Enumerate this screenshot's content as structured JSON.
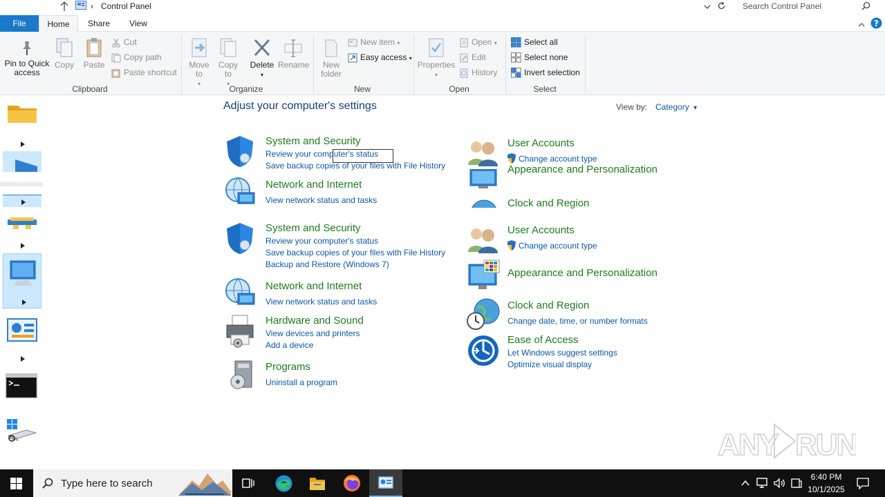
{
  "titlebar": {
    "location": "Control Panel",
    "search_placeholder": "Search Control Panel"
  },
  "tabs": [
    "File",
    "Home",
    "Share",
    "View"
  ],
  "ribbon": {
    "pin": "Pin to Quick access",
    "copy": "Copy",
    "paste": "Paste",
    "cut": "Cut",
    "copy_path": "Copy path",
    "paste_shortcut": "Paste shortcut",
    "clipboard": "Clipboard",
    "move_to": "Move to",
    "copy_to": "Copy to",
    "delete": "Delete",
    "rename": "Rename",
    "organize": "Organize",
    "new_folder": "New folder",
    "new_item": "New item",
    "easy_access": "Easy access",
    "new": "New",
    "properties": "Properties",
    "open": "Open",
    "edit": "Edit",
    "history": "History",
    "open_group": "Open",
    "select_all": "Select all",
    "select_none": "Select none",
    "invert_selection": "Invert selection",
    "select": "Select"
  },
  "content": {
    "heading": "Adjust your computer's settings",
    "view_by_label": "View by:",
    "view_by_value": "Category",
    "ghost": {
      "system_security": "System and Security",
      "review_status": "Review your computer's status",
      "save_backup": "Save backup copies of your files with File History",
      "network": "Network and Internet",
      "view_network": "View network status and tasks",
      "user_accounts": "User Accounts",
      "change_account": "Change account type",
      "appearance": "Appearance and Personalization",
      "clock": "Clock and Region"
    },
    "left": {
      "system_security": "System and Security",
      "review_status": "Review your computer's status",
      "save_backup": "Save backup copies of your files with File History",
      "backup_restore": "Backup and Restore (Windows 7)",
      "network": "Network and Internet",
      "view_network": "View network status and tasks",
      "hardware": "Hardware and Sound",
      "devices": "View devices and printers",
      "add_device": "Add a device",
      "programs": "Programs",
      "uninstall": "Uninstall a program"
    },
    "right": {
      "user_accounts": "User Accounts",
      "change_account": "Change account type",
      "appearance": "Appearance and Personalization",
      "clock": "Clock and Region",
      "change_date": "Change date, time, or number formats",
      "ease": "Ease of Access",
      "suggest": "Let Windows suggest settings",
      "optimize": "Optimize visual display"
    }
  },
  "taskbar": {
    "search_placeholder": "Type here to search",
    "time": "6:40 PM",
    "date": "10/1/2025"
  },
  "watermark": "ANY RUN"
}
